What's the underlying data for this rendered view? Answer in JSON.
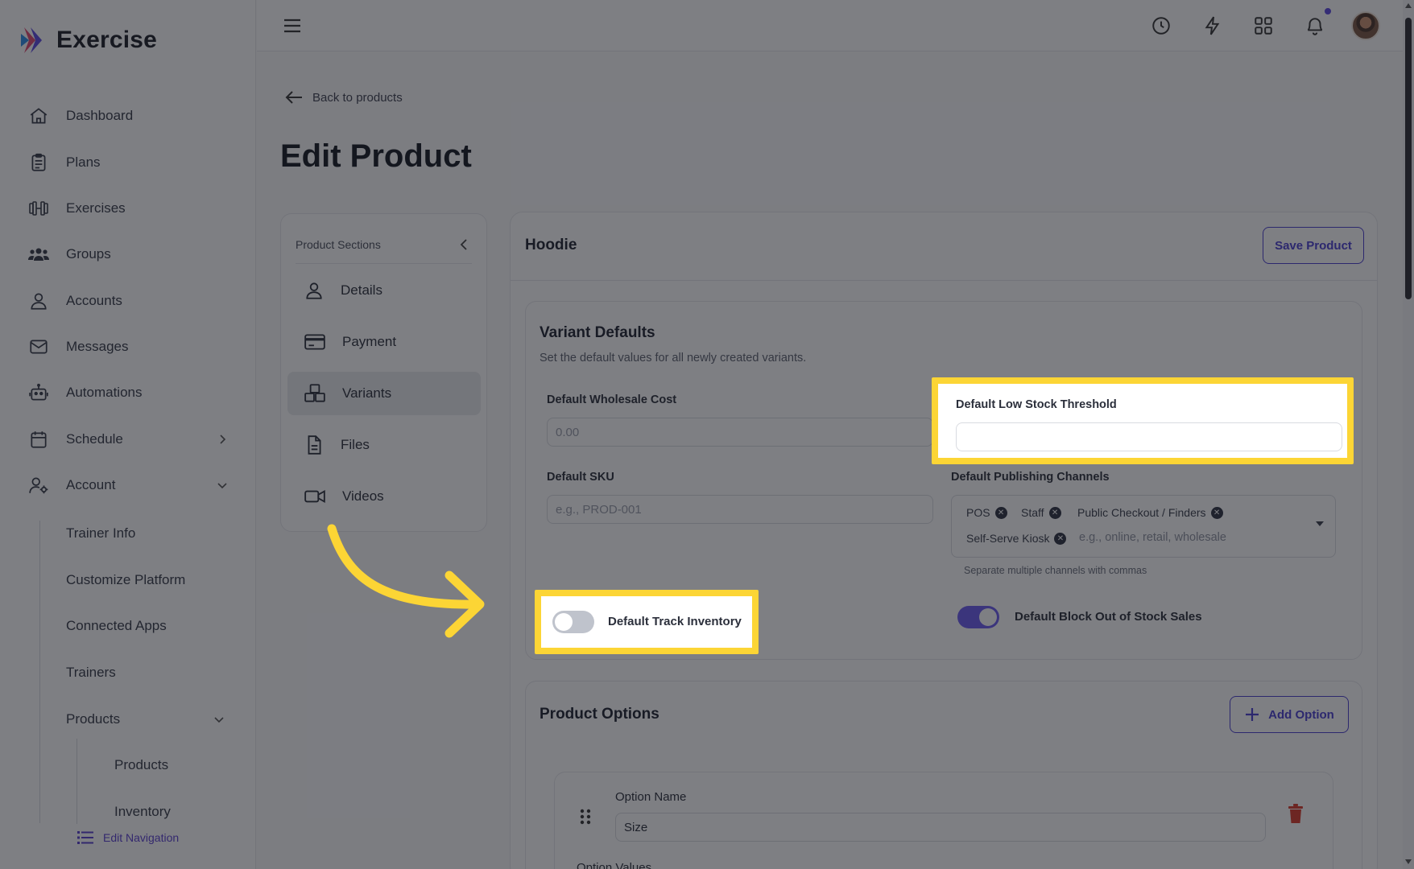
{
  "app": {
    "name": "Exercise"
  },
  "sidebar": {
    "items": [
      {
        "label": "Dashboard",
        "icon": "home-icon"
      },
      {
        "label": "Plans",
        "icon": "clipboard-icon"
      },
      {
        "label": "Exercises",
        "icon": "dumbbell-icon"
      },
      {
        "label": "Groups",
        "icon": "users-icon"
      },
      {
        "label": "Accounts",
        "icon": "user-icon"
      },
      {
        "label": "Messages",
        "icon": "mail-icon"
      },
      {
        "label": "Automations",
        "icon": "robot-icon"
      },
      {
        "label": "Schedule",
        "icon": "calendar-icon"
      },
      {
        "label": "Account",
        "icon": "user-gear-icon"
      }
    ],
    "account_subitems": [
      "Trainer Info",
      "Customize Platform",
      "Connected Apps",
      "Trainers",
      "Products"
    ],
    "products_subitems": [
      "Products",
      "Inventory"
    ],
    "edit_navigation": "Edit Navigation"
  },
  "main": {
    "back_link": "Back to products",
    "page_title": "Edit Product",
    "sections": {
      "header": "Product Sections",
      "items": [
        "Details",
        "Payment",
        "Variants",
        "Files",
        "Videos"
      ],
      "active": "Variants"
    },
    "product_name": "Hoodie",
    "save_button": "Save Product",
    "variant_defaults": {
      "title": "Variant Defaults",
      "subtitle": "Set the default values for all newly created variants.",
      "wholesale_cost_label": "Default Wholesale Cost",
      "wholesale_cost_placeholder": "0.00",
      "low_stock_label": "Default Low Stock Threshold",
      "low_stock_value": "",
      "sku_label": "Default SKU",
      "sku_placeholder": "e.g., PROD-001",
      "channels_label": "Default Publishing Channels",
      "channels": [
        "POS",
        "Staff",
        "Public Checkout / Finders",
        "Self-Serve Kiosk"
      ],
      "channels_placeholder": "e.g., online, retail, wholesale",
      "channels_helper": "Separate multiple channels with commas",
      "track_inventory_label": "Default Track Inventory",
      "track_inventory_on": false,
      "block_out_of_stock_label": "Default Block Out of Stock Sales",
      "block_out_of_stock_on": true
    },
    "product_options": {
      "title": "Product Options",
      "add_button": "Add Option",
      "option_name_label": "Option Name",
      "option_name_value": "Size",
      "option_values_label": "Option Values"
    }
  },
  "colors": {
    "accent": "#4b3ed1",
    "highlight": "#fcd535",
    "danger": "#d93a2b",
    "toggle_on": "#6b5cf0"
  }
}
